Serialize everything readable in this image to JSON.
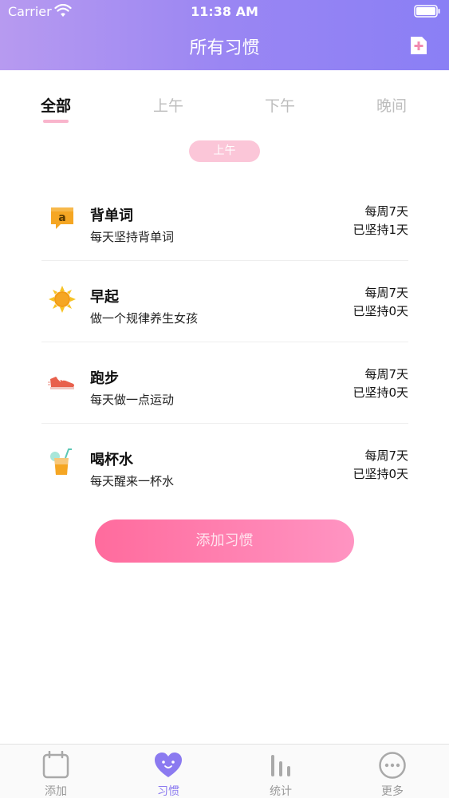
{
  "status_bar": {
    "carrier": "Carrier",
    "time": "11:38 AM"
  },
  "nav": {
    "title": "所有习惯"
  },
  "tabs": [
    {
      "label": "全部",
      "active": true
    },
    {
      "label": "上午",
      "active": false
    },
    {
      "label": "下午",
      "active": false
    },
    {
      "label": "晚间",
      "active": false
    }
  ],
  "section": {
    "label": "上午"
  },
  "habits": [
    {
      "icon": "speech-bubble-letter-icon",
      "name": "背单词",
      "desc": "每天坚持背单词",
      "freq": "每周7天",
      "streak": "已坚持1天"
    },
    {
      "icon": "sun-icon",
      "name": "早起",
      "desc": "做一个规律养生女孩",
      "freq": "每周7天",
      "streak": "已坚持0天"
    },
    {
      "icon": "running-shoe-icon",
      "name": "跑步",
      "desc": "每天做一点运动",
      "freq": "每周7天",
      "streak": "已坚持0天"
    },
    {
      "icon": "drink-cup-icon",
      "name": "喝杯水",
      "desc": "每天醒来一杯水",
      "freq": "每周7天",
      "streak": "已坚持0天"
    }
  ],
  "add_button": {
    "label": "添加习惯"
  },
  "tabbar": [
    {
      "icon": "calendar-icon",
      "label": "添加",
      "active": false
    },
    {
      "icon": "heart-face-icon",
      "label": "习惯",
      "active": true
    },
    {
      "icon": "bar-chart-icon",
      "label": "统计",
      "active": false
    },
    {
      "icon": "more-dots-icon",
      "label": "更多",
      "active": false
    }
  ],
  "colors": {
    "header_start": "#b79af0",
    "header_end": "#8a7ff5",
    "accent_pink": "#ff6b9d",
    "tab_active": "#8b7af0"
  }
}
